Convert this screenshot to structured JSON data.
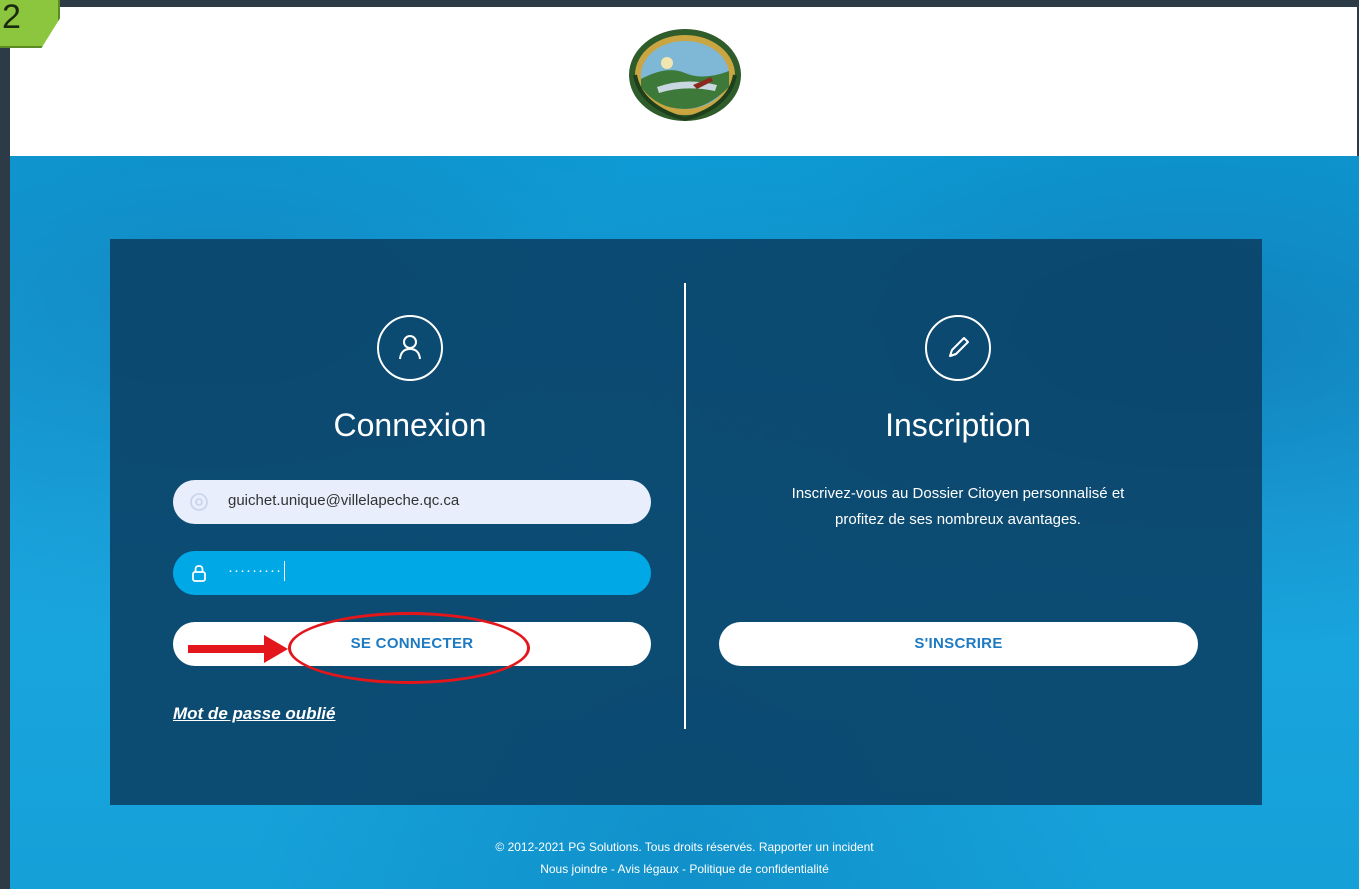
{
  "step": {
    "number": "2"
  },
  "header": {
    "logo_icon": "municipality-seal"
  },
  "login": {
    "icon": "user-icon",
    "title": "Connexion",
    "email_value": "guichet.unique@villelapeche.qc.ca",
    "password_value": "·········",
    "submit_label": "SE CONNECTER",
    "forgot_label": "Mot de passe oublié"
  },
  "signup": {
    "icon": "pencil-icon",
    "title": "Inscription",
    "description": "Inscrivez-vous au Dossier Citoyen personnalisé et profitez de ses nombreux avantages.",
    "button_label": "S'INSCRIRE"
  },
  "footer": {
    "copyright": "© 2012-2021 PG Solutions. Tous droits réservés. Rapporter un incident",
    "links": "Nous joindre - Avis légaux - Politique de confidentialité"
  },
  "colors": {
    "accent": "#1e7ac2",
    "input_active": "#00a9e6",
    "panel": "#0b3e62",
    "annotation": "#e3161b",
    "badge": "#8cc63f"
  }
}
